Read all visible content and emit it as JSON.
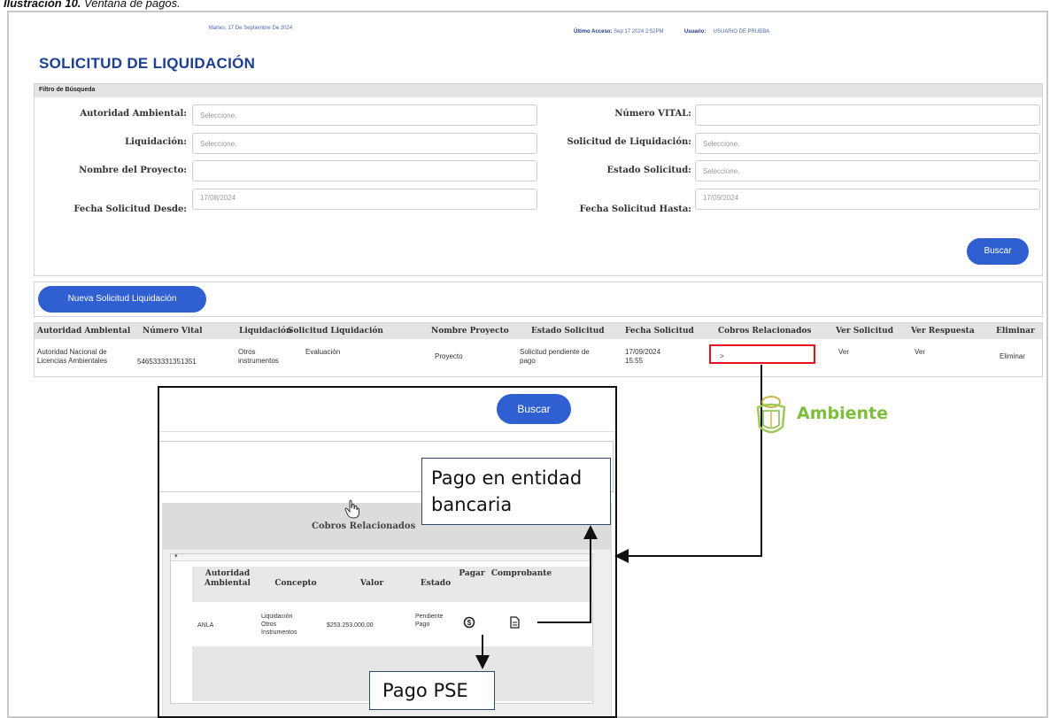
{
  "caption": {
    "bold": "Ilustración 10.",
    "rest": " Ventana de pagos."
  },
  "header": {
    "date": "Martes, 17 De Septiembre De 2024",
    "ultimo_acceso_label": "Último Acceso:",
    "ultimo_acceso_value": "Sep 17 2024 2:52PM",
    "usuario_label": "Usuario:",
    "usuario_value": "USUARIO DE PRUEBA",
    "title": "SOLICITUD DE LIQUIDACIÓN"
  },
  "filter": {
    "header": "Filtro de Búsqueda",
    "autoridad_label": "Autoridad Ambiental:",
    "autoridad_placeholder": "Seleccione.",
    "numero_vital_label": "Número VITAL:",
    "numero_vital_value": "",
    "liquidacion_label": "Liquidación:",
    "liquidacion_placeholder": "Seleccione.",
    "solicitud_liq_label": "Solicitud de Liquidación:",
    "solicitud_liq_placeholder": "Seleccione.",
    "nombre_proyecto_label": "Nombre del Proyecto:",
    "nombre_proyecto_value": "",
    "estado_label": "Estado Solicitud:",
    "estado_placeholder": "Seleccione.",
    "fecha_desde_label": "Fecha Solicitud Desde:",
    "fecha_desde_value": "17/08/2024",
    "fecha_hasta_label": "Fecha Solicitud Hasta:",
    "fecha_hasta_value": "17/09/2024",
    "buscar_label": "Buscar"
  },
  "nueva_label": "Nueva Solicitud Liquidación",
  "table": {
    "headers": [
      "Autoridad Ambiental",
      "Número Vital",
      "Liquidación",
      "Solicitud Liquidación",
      "Nombre Proyecto",
      "Estado Solicitud",
      "Fecha Solicitud",
      "Cobros Relacionados",
      "Ver Solicitud",
      "Ver Respuesta",
      "Eliminar"
    ],
    "row": {
      "autoridad": "Autoridad Nacional de Licencias Ambientales",
      "numero_vital": "546533331351351",
      "liquidacion": "Otros instrumentos",
      "solicitud": "Evaluación",
      "proyecto": "Proyecto",
      "estado": "Solicitud pendiente de pago",
      "fecha": "17/09/2024 15:55",
      "cobros": ">",
      "ver_solicitud": "Ver",
      "ver_respuesta": "Ver",
      "eliminar": "Eliminar"
    }
  },
  "inset": {
    "buscar_label": "Buscar",
    "cobros_title": "Cobros Relacionados",
    "collapse_glyph": "▾",
    "headers": [
      "Autoridad Ambiental",
      "Concepto",
      "Valor",
      "Estado",
      "Pagar",
      "Comprobante"
    ],
    "row": {
      "autoridad": "ANLA",
      "concepto": "Liquidación Otros Instrumentos",
      "valor": "$253.253.000,00",
      "estado": "Pendiente Pago"
    }
  },
  "callouts": {
    "banco": "Pago en entidad bancaria",
    "pse": "Pago PSE"
  },
  "logo_text": "Ambiente",
  "colors": {
    "title_blue": "#1c3f94",
    "button_blue": "#2f5fd0",
    "highlight_red": "#e2131c",
    "logo_green": "#7dbf3a"
  }
}
